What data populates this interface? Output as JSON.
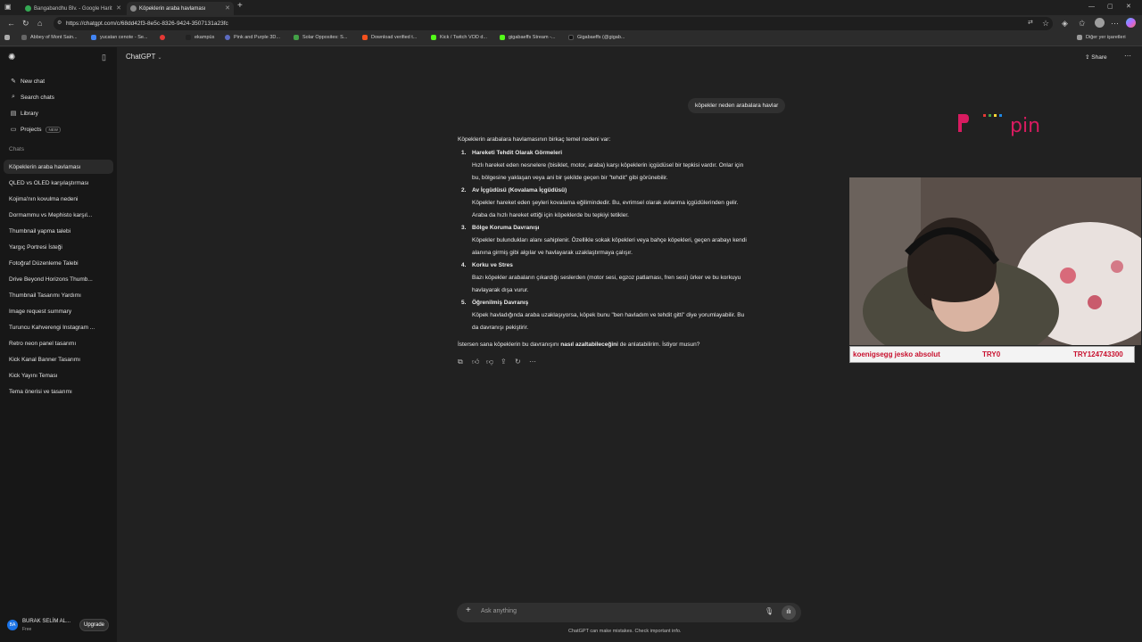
{
  "browser": {
    "tabs": [
      {
        "title": "Bangabandhu Blv. - Google Harit"
      },
      {
        "title": "Köpeklerin araba havlaması"
      }
    ],
    "url": "https://chatgpt.com/c/68dd42f3-8e5c-8326-9424-3507131a23fc",
    "bookmarks": [
      "Abbey of Mont Sain...",
      "yucatan cenote - Se...",
      "ekampüs",
      "Pink and Purple 3D...",
      "Solar Opposites: S...",
      "Download verified t...",
      "Kick / Twitch VOD d...",
      "gigabaeffs Stream -...",
      "Gigabaeffs (@gigab..."
    ],
    "other_bookmarks": "Diğer yer işaretleri"
  },
  "sidebar": {
    "new_chat": "New chat",
    "search_chats": "Search chats",
    "library": "Library",
    "projects": "Projects",
    "projects_badge": "NEW",
    "chats_header": "Chats",
    "chats": [
      "Köpeklerin araba havlaması",
      "QLED vs OLED karşılaştırması",
      "Kojima'nın kovulma nedeni",
      "Dormammu vs Mephisto karşıl...",
      "Thumbnail yapma talebi",
      "Yargıç Portresi İsteği",
      "Fotoğraf Düzenleme Talebi",
      "Drive Beyond Horizons Thumb...",
      "Thumbnail Tasarımı Yardımı",
      "Image request summary",
      "Turuncu Kahverengi Instagram ...",
      "Retro neon panel tasarımı",
      "Kick Kanal Banner Tasarımı",
      "Kick Yayını Teması",
      "Tema önerisi ve tasarımı"
    ],
    "user": {
      "initials": "BA",
      "name": "BURAK SELİM AL...",
      "plan": "Free",
      "upgrade": "Upgrade"
    }
  },
  "header": {
    "model": "ChatGPT",
    "share": "Share"
  },
  "conversation": {
    "user_message": "köpekler neden arabalara havlar",
    "intro": "Köpeklerin arabalara havlamasının birkaç temel nedeni var:",
    "points": [
      {
        "num": "1.",
        "title": "Hareketi Tehdit Olarak Görmeleri",
        "line1": "Hızlı hareket eden nesnelere (bisiklet, motor, araba) karşı köpeklerin içgüdüsel bir tepkisi vardır. Onlar için",
        "line2": "bu, bölgesine yaklaşan veya ani bir şekilde geçen bir \"tehdit\" gibi görünebilir."
      },
      {
        "num": "2.",
        "title": "Av İçgüdüsü (Kovalama İçgüdüsü)",
        "line1": "Köpekler hareket eden şeyleri kovalama eğilimindedir. Bu, evrimsel olarak avlanma içgüdülerinden gelir.",
        "line2": "Araba da hızlı hareket ettiği için köpeklerde bu tepkiyi tetikler."
      },
      {
        "num": "3.",
        "title": "Bölge Koruma Davranışı",
        "line1": "Köpekler bulundukları alanı sahiplenir. Özellikle sokak köpekleri veya bahçe köpekleri, geçen arabayı kendi",
        "line2": "alanına girmiş gibi algılar ve havlayarak uzaklaştırmaya çalışır."
      },
      {
        "num": "4.",
        "title": "Korku ve Stres",
        "line1": "Bazı köpekler arabaların çıkardığı seslerden (motor sesi, egzoz patlaması, fren sesi) ürker ve bu korkuyu",
        "line2": "havlayarak dışa vurur."
      },
      {
        "num": "5.",
        "title": "Öğrenilmiş Davranış",
        "line1": "Köpek havladığında araba uzaklaşıyorsa, köpek bunu \"ben havladım ve tehdit gitti\" diye yorumlayabilir. Bu",
        "line2": "da davranışı pekiştirir."
      }
    ],
    "closing_pre": "İstersen sana köpeklerin bu davranışını ",
    "closing_bold": "nasıl azaltabileceğini",
    "closing_post": " de anlatabilirim. İstiyor musun?"
  },
  "composer": {
    "placeholder": "Ask anything",
    "disclaimer": "ChatGPT can make mistakes. Check important info."
  },
  "overlay": {
    "logo_text": "pin",
    "ticker": [
      "koenigsegg jesko absolut",
      "TRY0",
      "TRY124743300"
    ]
  }
}
